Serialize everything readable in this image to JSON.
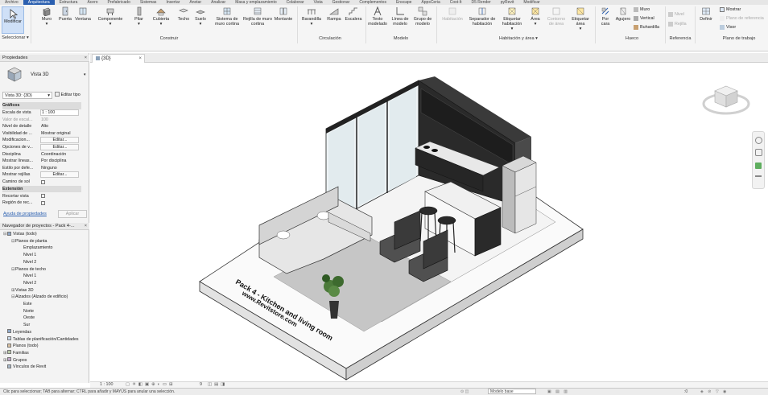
{
  "tabs": [
    "Archivo",
    "Arquitectura",
    "Estructura",
    "Acero",
    "Prefabricado",
    "Sistemas",
    "Insertar",
    "Anotar",
    "Analizar",
    "Masa y emplazamiento",
    "Colaborar",
    "Vista",
    "Gestionar",
    "Complementos",
    "Enscape",
    "AppsCeria",
    "Cost-It",
    "D5 Render",
    "pyRevit",
    "Modificar"
  ],
  "active_tab": "Arquitectura",
  "ribbon": {
    "modify": "Modificar",
    "select": "Seleccionar",
    "build": [
      "Muro",
      "Puerta",
      "Ventana",
      "Componente",
      "Pilar",
      "Cubierta",
      "Techo",
      "Suelo",
      "Sistema de muro cortina",
      "Rejilla de muro cortina",
      "Montante"
    ],
    "circulation": [
      "Barandilla",
      "Rampa",
      "Escalera"
    ],
    "model": [
      "Texto modelado",
      "Línea de modelo",
      "Grupo de modelo"
    ],
    "room": [
      "Habitación",
      "Separador de habitación",
      "Etiquetar habitación",
      "Área",
      "Contorno de área",
      "Etiquetar área"
    ],
    "opening": [
      "Por cara",
      "Agujero"
    ],
    "opening_small": [
      "Muro",
      "Vertical",
      "Buhardilla"
    ],
    "datum": [
      "Nivel",
      "Rejilla"
    ],
    "workplane": "Definir",
    "workplane_small": [
      "Mostrar",
      "Plano de referencia",
      "Visor"
    ],
    "groups": [
      "Seleccionar",
      "Construir",
      "Circulación",
      "Modelo",
      "Habitación y área",
      "Hueco",
      "Referencia",
      "Plano de trabajo"
    ]
  },
  "view_tab": {
    "title": "{3D}",
    "close": "×"
  },
  "properties": {
    "title": "Propiedades",
    "type_name": "Vista 3D",
    "selector": "Vista 3D: {3D}",
    "edit_type": "Editar tipo",
    "section_graphics": "Gráficos",
    "rows": [
      {
        "k": "Escala de vista",
        "v": "1 : 100",
        "kind": "box"
      },
      {
        "k": "Valor de escal...",
        "v": "100",
        "kind": "dis"
      },
      {
        "k": "Nivel de detalle",
        "v": "Alto",
        "kind": "text"
      },
      {
        "k": "Visibilidad de ...",
        "v": "Mostrar original",
        "kind": "text"
      },
      {
        "k": "Modificacion...",
        "v": "Editar...",
        "kind": "btn"
      },
      {
        "k": "Opciones de v...",
        "v": "Editar...",
        "kind": "btn"
      },
      {
        "k": "Disciplina",
        "v": "Coordinación",
        "kind": "text"
      },
      {
        "k": "Mostrar líneas...",
        "v": "Por disciplina",
        "kind": "text"
      },
      {
        "k": "Estilo por defe...",
        "v": "Ninguno",
        "kind": "text"
      },
      {
        "k": "Mostrar rejillas",
        "v": "Editar...",
        "kind": "btn"
      },
      {
        "k": "Camino de sol",
        "v": "",
        "kind": "cb"
      }
    ],
    "section_extent": "Extensión",
    "extent_rows": [
      {
        "k": "Recortar vista",
        "v": "",
        "kind": "cb"
      },
      {
        "k": "Región de rec...",
        "v": "",
        "kind": "cb"
      }
    ],
    "help": "Ayuda de propiedades",
    "apply": "Aplicar"
  },
  "browser": {
    "title": "Navegador de proyectos - Pack 4-...",
    "items": [
      {
        "label": "Vistas (todo)",
        "lvl": 0,
        "tw": "⊟"
      },
      {
        "label": "Planos de planta",
        "lvl": 1,
        "tw": "⊟"
      },
      {
        "label": "Emplazamiento",
        "lvl": 2,
        "tw": ""
      },
      {
        "label": "Nivel 1",
        "lvl": 2,
        "tw": ""
      },
      {
        "label": "Nivel 2",
        "lvl": 2,
        "tw": ""
      },
      {
        "label": "Planos de techo",
        "lvl": 1,
        "tw": "⊟"
      },
      {
        "label": "Nivel 1",
        "lvl": 2,
        "tw": ""
      },
      {
        "label": "Nivel 2",
        "lvl": 2,
        "tw": ""
      },
      {
        "label": "Vistas 3D",
        "lvl": 1,
        "tw": "⊞"
      },
      {
        "label": "Alzados (Alzado de edificio)",
        "lvl": 1,
        "tw": "⊟"
      },
      {
        "label": "Este",
        "lvl": 2,
        "tw": ""
      },
      {
        "label": "Norte",
        "lvl": 2,
        "tw": ""
      },
      {
        "label": "Oeste",
        "lvl": 2,
        "tw": ""
      },
      {
        "label": "Sur",
        "lvl": 2,
        "tw": ""
      },
      {
        "label": "Leyendas",
        "lvl": 0,
        "tw": ""
      },
      {
        "label": "Tablas de planificación/Cantidades",
        "lvl": 0,
        "tw": ""
      },
      {
        "label": "Planos (todo)",
        "lvl": 0,
        "tw": ""
      },
      {
        "label": "Familias",
        "lvl": 0,
        "tw": "⊞"
      },
      {
        "label": "Grupos",
        "lvl": 0,
        "tw": "⊞"
      },
      {
        "label": "Vínculos de Revit",
        "lvl": 0,
        "tw": ""
      }
    ]
  },
  "view_control": {
    "scale": "1 : 100",
    "num": "9"
  },
  "status": {
    "text": "Clic para seleccionar; TAB para alternar; CTRL para añadir y MAYÚS para anular una selección.",
    "model": "Modelo base",
    "zero": ":0"
  },
  "model_label": {
    "line1": "Pack 4 - Kitchen and living room",
    "line2": "www.Revitstore.com"
  },
  "colors": {
    "accent": "#2a5fb0",
    "panel": "#f3f3f3",
    "ribbon": "#f5f5f5"
  }
}
